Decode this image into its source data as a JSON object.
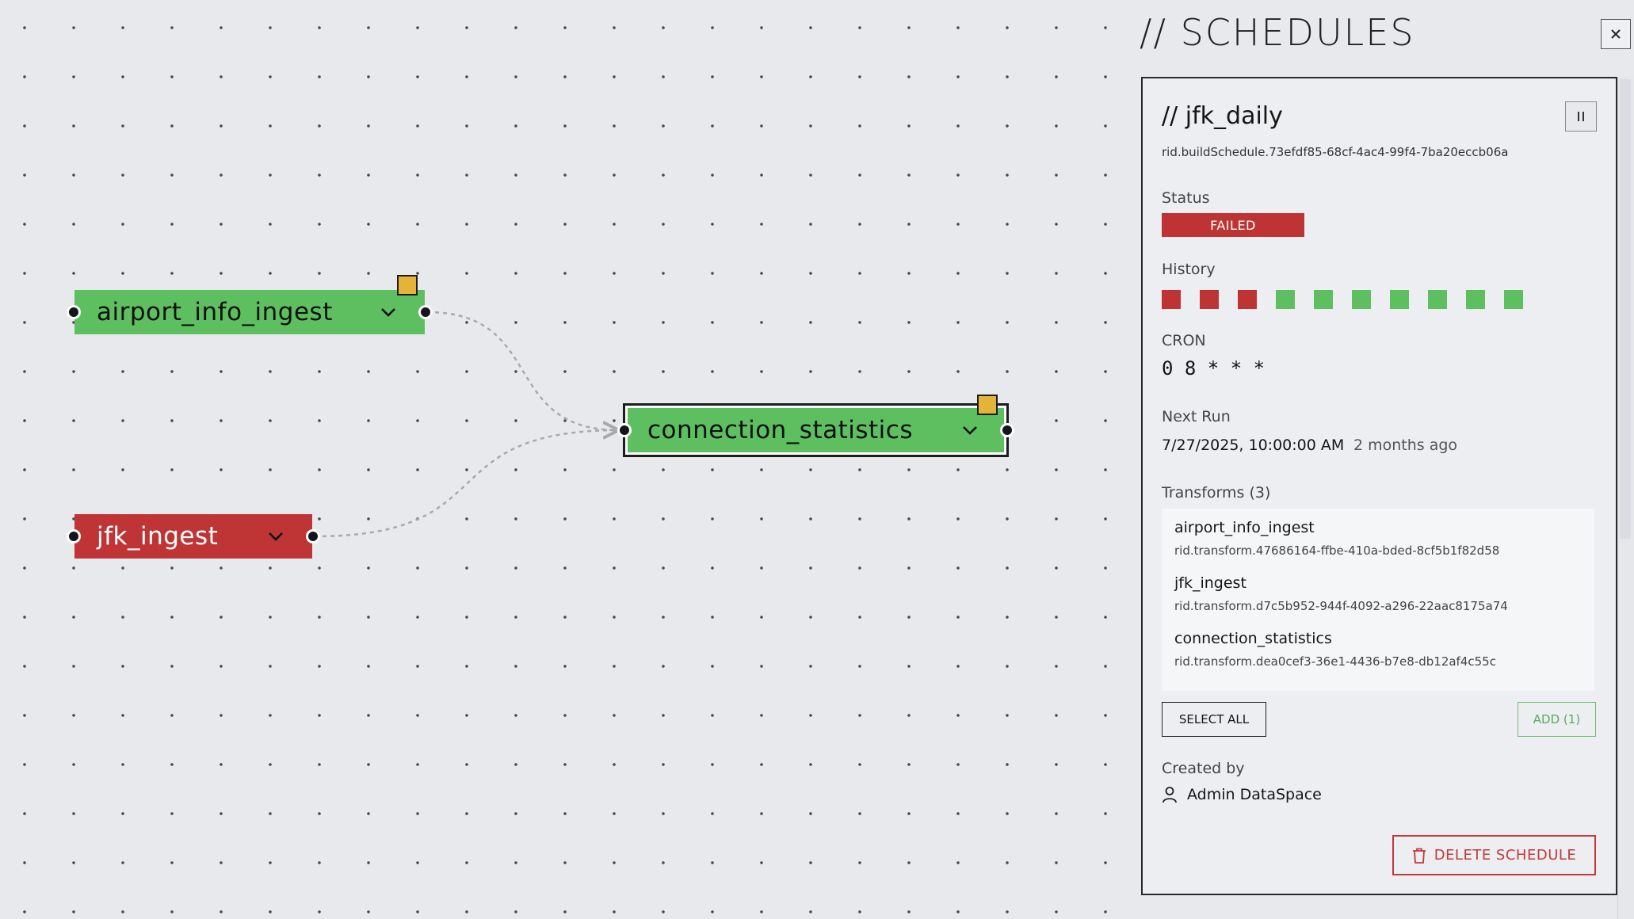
{
  "graph": {
    "nodes": [
      {
        "id": "airport",
        "label": "airport_info_ingest",
        "state": "ok",
        "has_flag": true,
        "selected": false
      },
      {
        "id": "jfk",
        "label": "jfk_ingest",
        "state": "fail",
        "has_flag": false,
        "selected": false
      },
      {
        "id": "conn",
        "label": "connection_statistics",
        "state": "ok",
        "has_flag": true,
        "selected": true
      }
    ],
    "edges": [
      {
        "from": "airport_info_ingest",
        "to": "connection_statistics"
      },
      {
        "from": "jfk_ingest",
        "to": "connection_statistics"
      }
    ],
    "colors": {
      "ok": "#5ebf60",
      "fail": "#bf3535",
      "flag": "#e3b33a",
      "edge": "#a9a9ab"
    }
  },
  "panel": {
    "title": "// SCHEDULES",
    "close_icon": "close-icon",
    "schedule": {
      "name": "// jfk_daily",
      "rid": "rid.buildSchedule.73efdf85-68cf-4ac4-99f4-7ba20eccb06a",
      "status_label": "Status",
      "status": "FAILED",
      "history_label": "History",
      "history": [
        "failed",
        "failed",
        "failed",
        "success",
        "success",
        "success",
        "success",
        "success",
        "success",
        "success"
      ],
      "cron_label": "CRON",
      "cron": "0 8 * * *",
      "next_run_label": "Next Run",
      "next_run": "7/27/2025, 10:00:00 AM",
      "next_run_relative": "2 months ago",
      "transforms_label": "Transforms (3)",
      "transforms": [
        {
          "name": "airport_info_ingest",
          "rid": "rid.transform.47686164-ffbe-410a-bded-8cf5b1f82d58"
        },
        {
          "name": "jfk_ingest",
          "rid": "rid.transform.d7c5b952-944f-4092-a296-22aac8175a74"
        },
        {
          "name": "connection_statistics",
          "rid": "rid.transform.dea0cef3-36e1-4436-b7e8-db12af4c55c"
        }
      ],
      "select_all": "SELECT ALL",
      "add": "ADD (1)",
      "created_by_label": "Created by",
      "created_by": "Admin DataSpace",
      "delete": "DELETE SCHEDULE"
    },
    "colors": {
      "failed": "#be3434",
      "success": "#5ebf60",
      "delete": "#c23a3a",
      "add": "#56ad5a"
    }
  }
}
